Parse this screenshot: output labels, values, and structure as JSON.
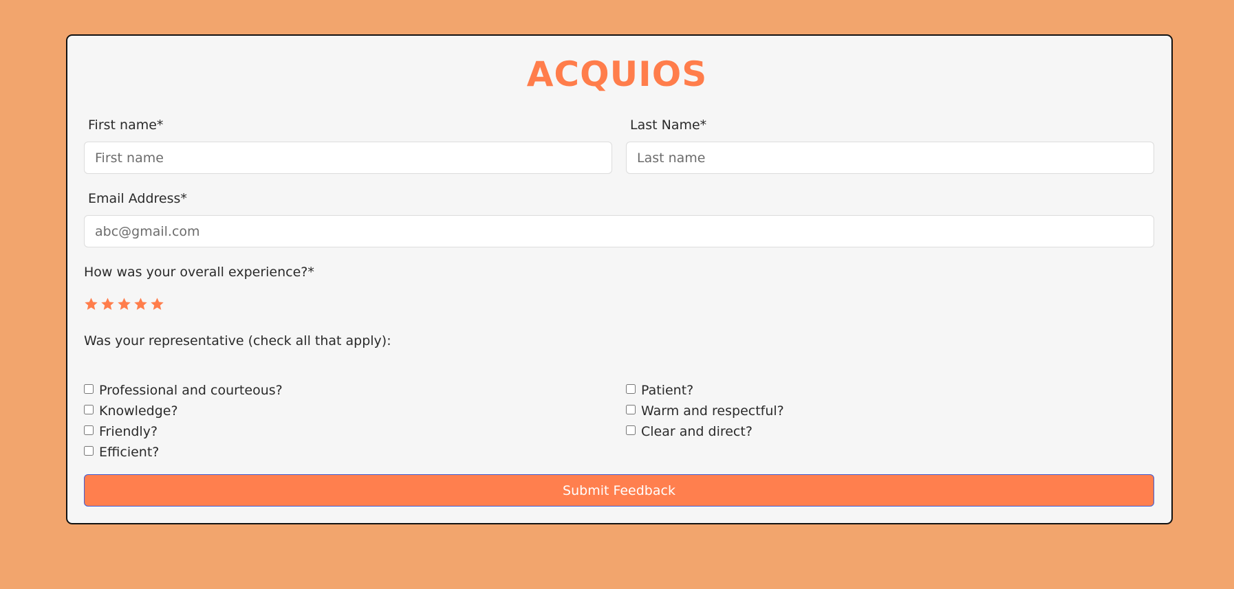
{
  "colors": {
    "page_background": "#f2a56d",
    "card_background": "#f6f6f6",
    "accent": "#ff7d4b",
    "submit_border": "#3b5bd6"
  },
  "form": {
    "title": "ACQUIOS",
    "first_name": {
      "label": "First name*",
      "placeholder": "First name",
      "value": ""
    },
    "last_name": {
      "label": "Last Name*",
      "placeholder": "Last name",
      "value": ""
    },
    "email": {
      "label": "Email Address*",
      "placeholder": "abc@gmail.com",
      "value": ""
    },
    "rating": {
      "question": "How was your overall experience?*",
      "max_stars": 5,
      "star_icon": "star-icon"
    },
    "representative": {
      "question": "Was your representative (check all that apply):",
      "left_options": [
        "Professional and courteous?",
        "Knowledge?",
        "Friendly?",
        "Efficient?"
      ],
      "right_options": [
        "Patient?",
        "Warm and respectful?",
        "Clear and direct?"
      ]
    },
    "submit_label": "Submit Feedback"
  }
}
